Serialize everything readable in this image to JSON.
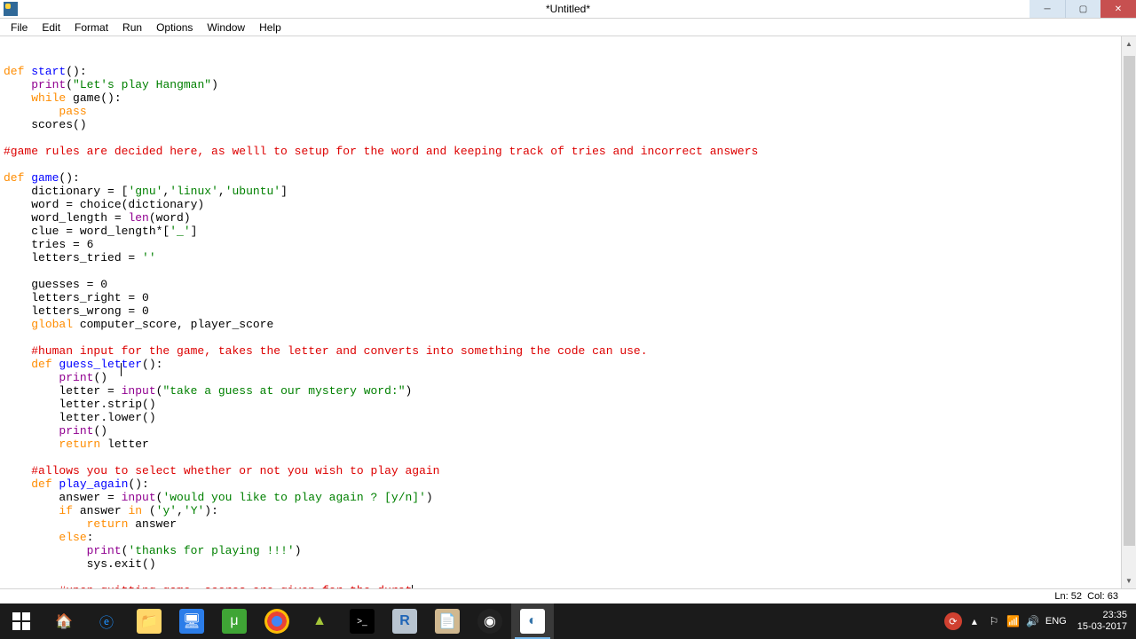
{
  "window": {
    "title": "*Untitled*"
  },
  "menu": {
    "file": "File",
    "edit": "Edit",
    "format": "Format",
    "run": "Run",
    "options": "Options",
    "window": "Window",
    "help": "Help"
  },
  "code": {
    "l1_kw": "def",
    "l1_name": " start",
    "l1_rest": "():",
    "l2a": "    ",
    "l2b": "print",
    "l2c": "(",
    "l2d": "\"Let's play Hangman\"",
    "l2e": ")",
    "l3a": "    ",
    "l3b": "while",
    "l3c": " game():",
    "l4a": "        ",
    "l4b": "pass",
    "l5": "    scores()",
    "l6": "#game rules are decided here, as welll to setup for the word and keeping track of tries and incorrect answers",
    "l7a": "def",
    "l7b": " game",
    "l7c": "():",
    "l8a": "    dictionary = [",
    "l8b": "'gnu'",
    "l8c": ",",
    "l8d": "'linux'",
    "l8e": ",",
    "l8f": "'ubuntu'",
    "l8g": "]",
    "l9": "    word = choice(dictionary)",
    "l10a": "    word_length = ",
    "l10b": "len",
    "l10c": "(word)",
    "l11a": "    clue = word_length*[",
    "l11b": "'_'",
    "l11c": "]",
    "l12a": "    tries = ",
    "l12b": "6",
    "l13a": "    letters_tried = ",
    "l13b": "''",
    "l14a": "    guesses = ",
    "l14b": "0",
    "l15a": "    letters_right = ",
    "l15b": "0",
    "l16a": "    letters_wrong = ",
    "l16b": "0",
    "l17a": "    ",
    "l17b": "global",
    "l17c": " computer_score, player_score",
    "l18": "    #human input for the game, takes the letter and converts into something the code can use.",
    "l19a": "    ",
    "l19b": "def",
    "l19c": " guess_letter",
    "l19d": "():",
    "l20a": "        ",
    "l20b": "print",
    "l20c": "()",
    "l21a": "        letter = ",
    "l21b": "input",
    "l21c": "(",
    "l21d": "\"take a guess at our mystery word:\"",
    "l21e": ")",
    "l22": "        letter.strip()",
    "l23": "        letter.lower()",
    "l24a": "        ",
    "l24b": "print",
    "l24c": "()",
    "l25a": "        ",
    "l25b": "return",
    "l25c": " letter",
    "l26": "    #allows you to select whether or not you wish to play again",
    "l27a": "    ",
    "l27b": "def",
    "l27c": " play_again",
    "l27d": "():",
    "l28a": "        answer = ",
    "l28b": "input",
    "l28c": "(",
    "l28d": "'would you like to play again ? [y/n]'",
    "l28e": ")",
    "l29a": "        ",
    "l29b": "if",
    "l29c": " answer ",
    "l29d": "in",
    "l29e": " (",
    "l29f": "'y'",
    "l29g": ",",
    "l29h": "'Y'",
    "l29i": "):",
    "l30a": "            ",
    "l30b": "return",
    "l30c": " answer",
    "l31a": "        ",
    "l31b": "else",
    "l31c": ":",
    "l32a": "            ",
    "l32b": "print",
    "l32c": "(",
    "l32d": "'thanks for playing !!!'",
    "l32e": ")",
    "l33": "            sys.exit()",
    "l34": "        #upon quitting game, scores are given for the durat"
  },
  "status": {
    "ln": "Ln: 52",
    "col": "Col: 63"
  },
  "tray": {
    "lang": "ENG",
    "time": "23:35",
    "date": "15-03-2017"
  }
}
